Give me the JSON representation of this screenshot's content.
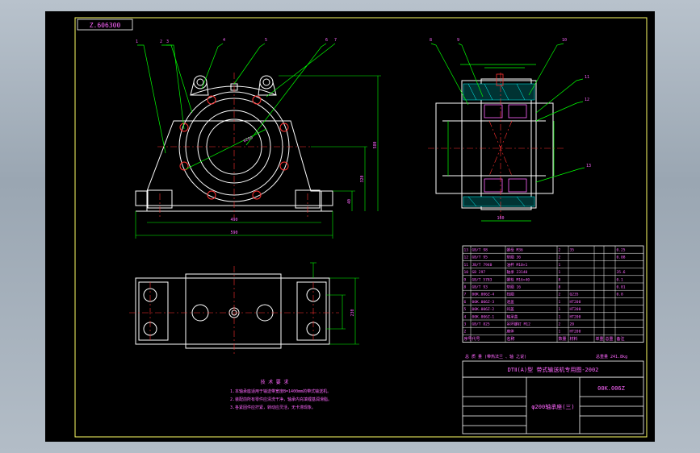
{
  "drawing_id": "Z.606300",
  "title_block": {
    "standard": "DTⅡ(A)型 带式输送机专用图-2002",
    "drawing_number": "00K.006Z",
    "part_name": "φ200轴承座(三)",
    "totals_label": "总 质 量 (带热法兰 、轴 之说)",
    "weight_note": "总重量 241.8kg",
    "header_cols": [
      "序号",
      "代号",
      "名称",
      "数量",
      "材料",
      "单重",
      "总重",
      "备注"
    ]
  },
  "bom_rows": [
    {
      "no": "13",
      "code": "GB/T 98",
      "name": "螺母 M36",
      "qty": "2",
      "mat": "35",
      "note": "0.25"
    },
    {
      "no": "12",
      "code": "GB/T 95",
      "name": "垫圈 36",
      "qty": "2",
      "mat": "",
      "note": "0.08"
    },
    {
      "no": "11",
      "code": "JB/T 7940",
      "name": "油杯 M10×1",
      "qty": "1",
      "mat": "",
      "note": ""
    },
    {
      "no": "10",
      "code": "GB 297",
      "name": "轴承 23140",
      "qty": "1",
      "mat": "",
      "note": "35.6"
    },
    {
      "no": "9",
      "code": "GB/T 5783",
      "name": "螺栓 M16×40",
      "qty": "8",
      "mat": "",
      "note": "0.1"
    },
    {
      "no": "8",
      "code": "GB/T 93",
      "name": "垫圈 16",
      "qty": "8",
      "mat": "",
      "note": "0.01"
    },
    {
      "no": "7",
      "code": "00K.006Z-4",
      "name": "挡圈",
      "qty": "2",
      "mat": "Q235",
      "note": "0.8"
    },
    {
      "no": "6",
      "code": "00K.006Z-3",
      "name": "透盖",
      "qty": "1",
      "mat": "HT200",
      "note": ""
    },
    {
      "no": "5",
      "code": "00K.006Z-2",
      "name": "闷盖",
      "qty": "1",
      "mat": "HT200",
      "note": ""
    },
    {
      "no": "4",
      "code": "00K.006Z-1",
      "name": "轴承盖",
      "qty": "1",
      "mat": "HT200",
      "note": ""
    },
    {
      "no": "3",
      "code": "GB/T 825",
      "name": "吊环螺钉 M12",
      "qty": "2",
      "mat": "20",
      "note": ""
    },
    {
      "no": "2",
      "code": "",
      "name": "座体",
      "qty": "1",
      "mat": "HT200",
      "note": ""
    }
  ],
  "notes": {
    "heading": "技 术 要 求",
    "lines": [
      "1.本轴承座适用于输送带宽度B=1400mm的带式输送机。",
      "2.装配前所有零件应清洗干净，轴承内充填锂基润滑脂。",
      "3.各紧固件应拧紧，转动应灵活，无卡滞现象。"
    ]
  },
  "dims": {
    "front_width": "590",
    "bolt_span": "490",
    "center_height": "320",
    "overall_height": "580",
    "base_height": "40",
    "base_depth": "230",
    "section_width": "160",
    "bore": "φ200"
  },
  "balloons": [
    "1",
    "2",
    "3",
    "4",
    "5",
    "6",
    "7",
    "8",
    "9",
    "10",
    "11",
    "12",
    "13"
  ],
  "colors": {
    "background": "#000000",
    "outline": "#ffffff",
    "leader": "#00ff00",
    "text": "#ff00ff",
    "center": "#ff3030",
    "frame": "#ffff66",
    "cyan": "#00ffff"
  }
}
